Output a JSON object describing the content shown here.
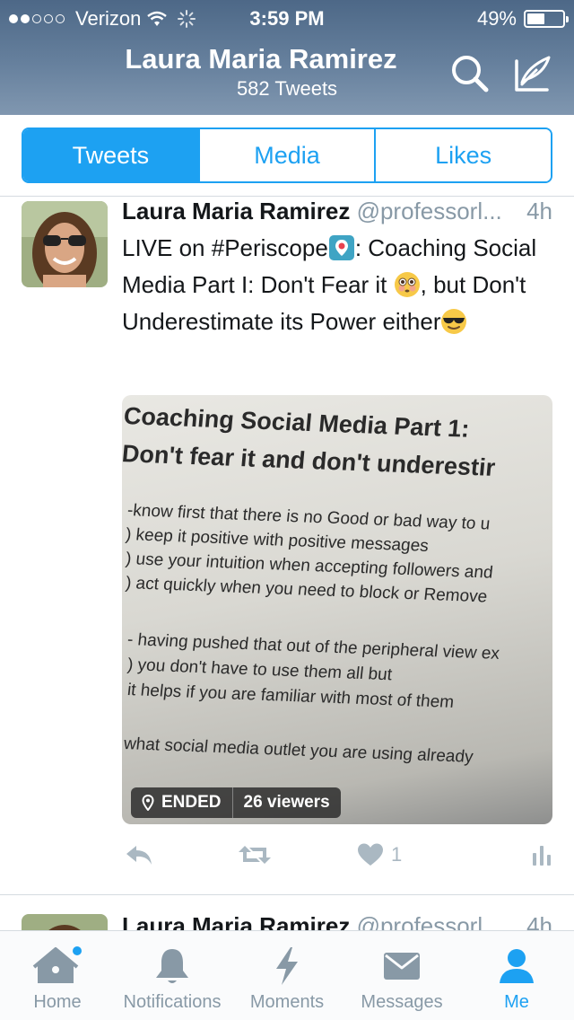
{
  "status_bar": {
    "carrier": "Verizon",
    "time": "3:59 PM",
    "battery": "49%",
    "battery_level": 0.49,
    "signal_bars_filled": 2,
    "signal_bars_total": 5
  },
  "header": {
    "name": "Laura Maria Ramirez",
    "tweet_count": "582 Tweets",
    "search_icon": "search-icon",
    "compose_icon": "compose-icon"
  },
  "tabs": [
    {
      "label": "Tweets",
      "active": true
    },
    {
      "label": "Media",
      "active": false
    },
    {
      "label": "Likes",
      "active": false
    }
  ],
  "tweet": {
    "name": "Laura Maria Ramirez",
    "handle": "@professorl...",
    "time": "4h",
    "text_part1": "LIVE on #Periscope",
    "text_part2": ": Coaching Social Media Part I: Don't Fear it ",
    "text_part3": ", but Don't Underestimate its Power either",
    "media": {
      "title_lines": [
        "Coaching Social Media Part 1:",
        "Don't fear it and don't underestir"
      ],
      "body_lines": [
        "-know first that there is no Good or bad way to u",
        ") keep it positive with positive messages",
        ") use your intuition when accepting followers and",
        ") act quickly when you need to block or Remove",
        "- having pushed that out of the peripheral view ex",
        ") you don't have to use them all but",
        "it helps if you are familiar with most of them",
        "what social media outlet you are using already"
      ],
      "status": "ENDED",
      "viewers": "26 viewers"
    },
    "likes": "1"
  },
  "tweet2": {
    "name": "Laura Maria Ramirez",
    "handle": "@professorl...",
    "time": "4h"
  },
  "tabbar": [
    {
      "label": "Home",
      "icon": "home-icon",
      "active": false
    },
    {
      "label": "Notifications",
      "icon": "bell-icon",
      "active": false
    },
    {
      "label": "Moments",
      "icon": "lightning-icon",
      "active": false
    },
    {
      "label": "Messages",
      "icon": "envelope-icon",
      "active": false
    },
    {
      "label": "Me",
      "icon": "person-icon",
      "active": true
    }
  ],
  "colors": {
    "accent": "#1da1f2",
    "header": "#5f7896",
    "muted": "#8899a6",
    "icon_gray": "#aab8c2"
  }
}
